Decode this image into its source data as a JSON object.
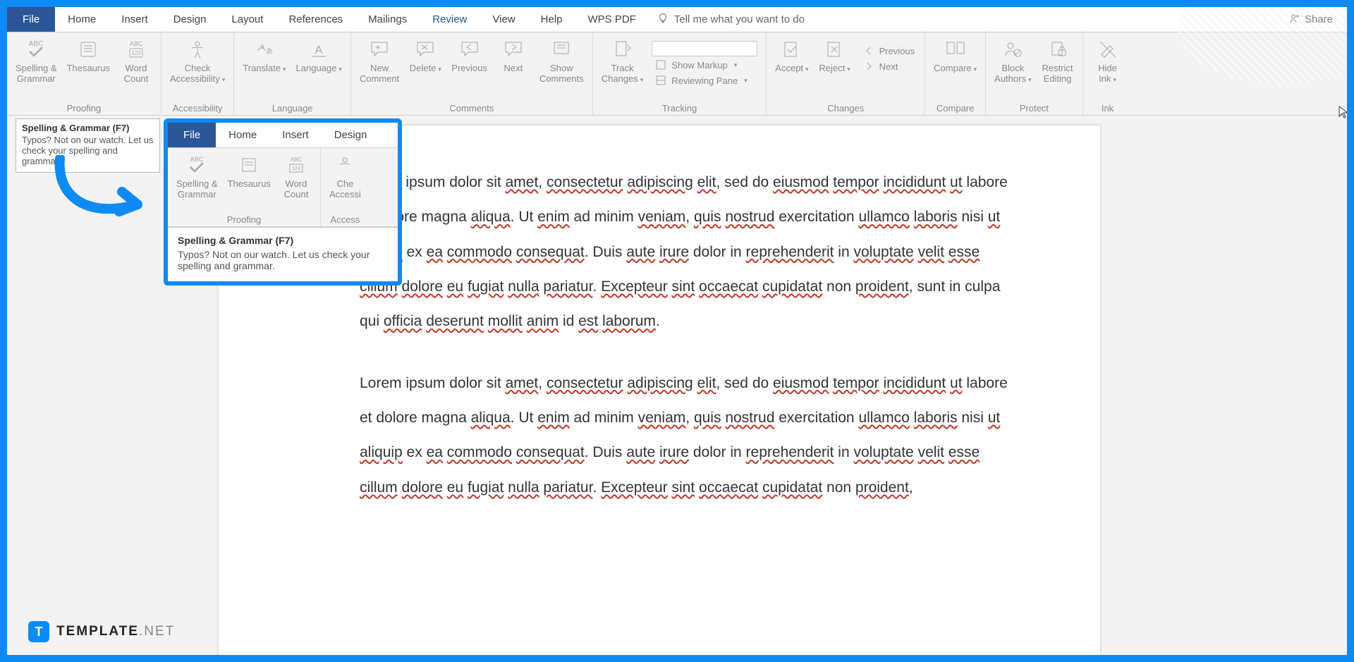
{
  "tabs": {
    "file": "File",
    "items": [
      "Home",
      "Insert",
      "Design",
      "Layout",
      "References",
      "Mailings",
      "Review",
      "View",
      "Help",
      "WPS PDF"
    ],
    "active": "Review",
    "tell_me": "Tell me what you want to do",
    "share": "Share"
  },
  "ribbon": {
    "proofing": {
      "label": "Proofing",
      "spelling": "Spelling &\nGrammar",
      "thesaurus": "Thesaurus",
      "word_count": "Word\nCount"
    },
    "accessibility": {
      "label": "Accessibility",
      "check": "Check\nAccessibility"
    },
    "language": {
      "label": "Language",
      "translate": "Translate",
      "language": "Language"
    },
    "comments": {
      "label": "Comments",
      "new": "New\nComment",
      "delete": "Delete",
      "previous": "Previous",
      "next": "Next",
      "show": "Show\nComments"
    },
    "tracking": {
      "label": "Tracking",
      "track": "Track\nChanges",
      "show_markup": "Show Markup",
      "reviewing_pane": "Reviewing Pane"
    },
    "changes": {
      "label": "Changes",
      "accept": "Accept",
      "reject": "Reject",
      "previous": "Previous",
      "next": "Next"
    },
    "compare": {
      "label": "Compare",
      "compare": "Compare"
    },
    "protect": {
      "label": "Protect",
      "block": "Block\nAuthors",
      "restrict": "Restrict\nEditing"
    },
    "ink": {
      "label": "Ink",
      "hide": "Hide\nInk"
    }
  },
  "tooltip": {
    "title": "Spelling & Grammar (F7)",
    "body": "Typos? Not on our watch. Let us check your spelling and grammar."
  },
  "inset": {
    "tabs": {
      "file": "File",
      "home": "Home",
      "insert": "Insert",
      "design": "Design"
    },
    "proofing_label": "Proofing",
    "access_label": "Access",
    "spelling": "Spelling &\nGrammar",
    "thesaurus": "Thesaurus",
    "word_count": "Word\nCount",
    "check": "Che\nAccessi",
    "tooltip_title": "Spelling & Grammar (F7)",
    "tooltip_body": "Typos? Not on our watch. Let us check your spelling and grammar."
  },
  "doc": {
    "p1_prefix": "em ipsum dolor sit ",
    "p2_prefix": "Lorem ipsum dolor sit "
  },
  "watermark": {
    "template": "TEMPLATE",
    "net": ".NET"
  }
}
